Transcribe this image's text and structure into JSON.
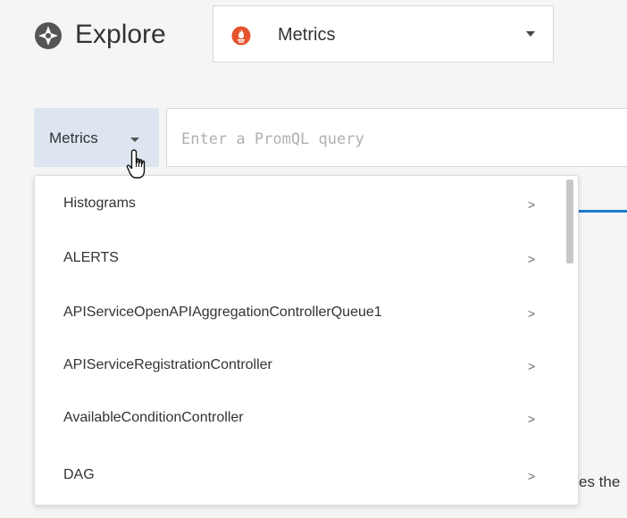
{
  "header": {
    "explore_icon": "compass-icon",
    "title": "Explore",
    "datasource": {
      "icon": "prometheus-icon",
      "label": "Metrics",
      "caret": "caret-down-icon"
    }
  },
  "query_bar": {
    "metrics_button_label": "Metrics",
    "query_placeholder": "Enter a PromQL query"
  },
  "dropdown": {
    "items": [
      {
        "label": "Histograms",
        "chevron": ">"
      },
      {
        "label": "ALERTS",
        "chevron": ">"
      },
      {
        "label": "APIServiceOpenAPIAggregationControllerQueue1",
        "chevron": ">"
      },
      {
        "label": "APIServiceRegistrationController",
        "chevron": ">"
      },
      {
        "label": "AvailableConditionController",
        "chevron": ">"
      },
      {
        "label": "DAG",
        "chevron": ">"
      }
    ]
  },
  "background": {
    "truncated_text": "es the"
  },
  "colors": {
    "accent": "#1f78d1",
    "prometheus": "#e6522c",
    "metrics_button_bg": "#dde6f0"
  }
}
